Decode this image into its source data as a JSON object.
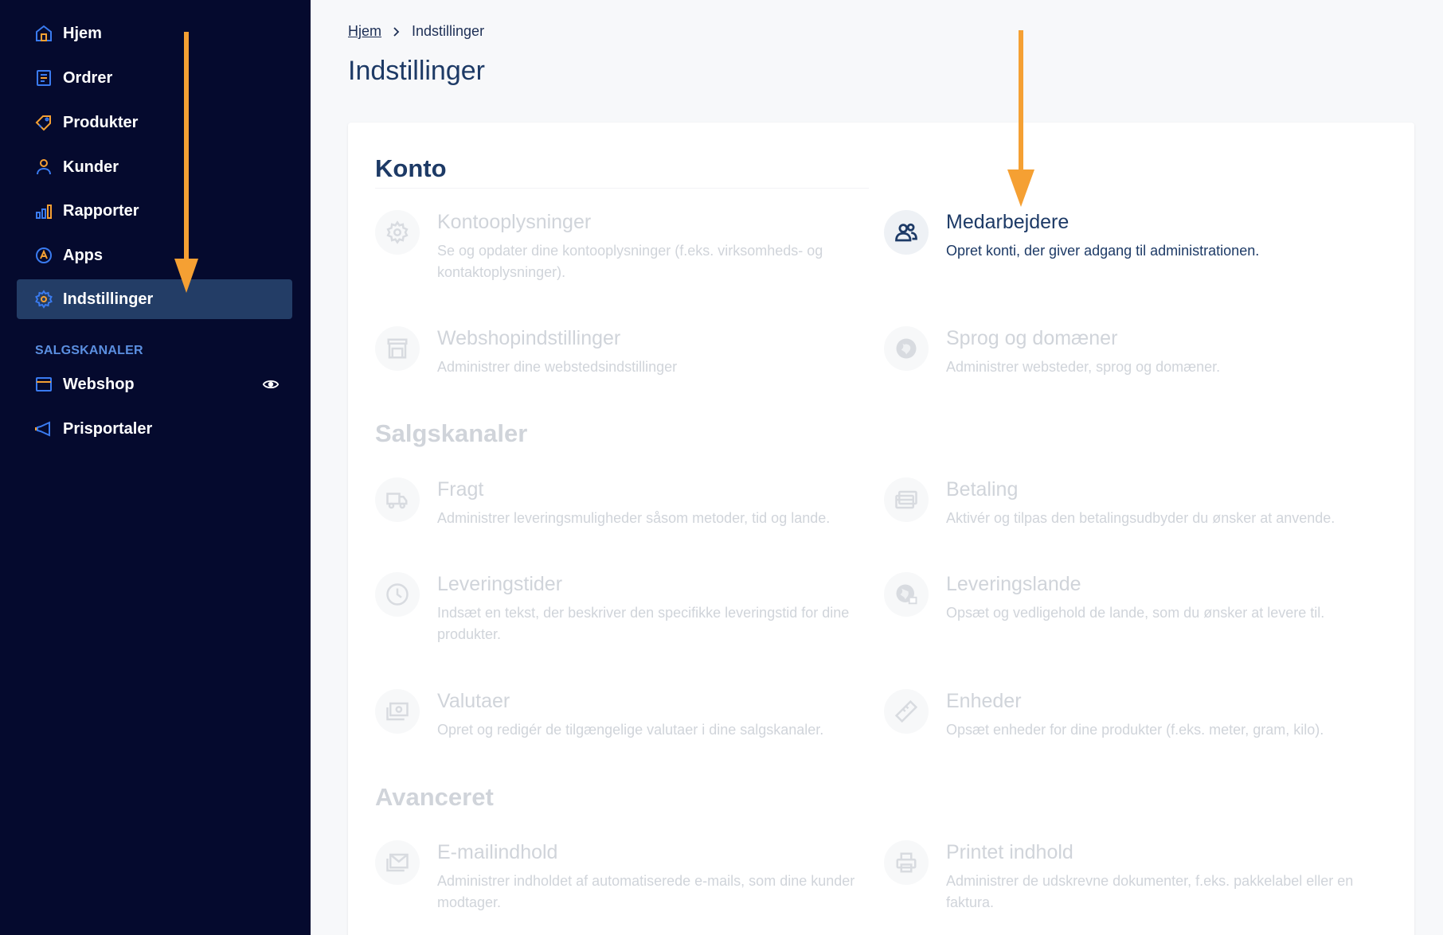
{
  "sidebar": {
    "items": [
      {
        "label": "Hjem",
        "icon": "home-icon"
      },
      {
        "label": "Ordrer",
        "icon": "orders-icon"
      },
      {
        "label": "Produkter",
        "icon": "tag-icon"
      },
      {
        "label": "Kunder",
        "icon": "user-icon"
      },
      {
        "label": "Rapporter",
        "icon": "chart-icon"
      },
      {
        "label": "Apps",
        "icon": "apps-icon"
      },
      {
        "label": "Indstillinger",
        "icon": "gear-icon",
        "active": true
      }
    ],
    "section_label": "SALGSKANALER",
    "channels": [
      {
        "label": "Webshop",
        "icon": "store-icon",
        "badge_icon": "eye-icon"
      },
      {
        "label": "Prisportaler",
        "icon": "megaphone-icon"
      }
    ]
  },
  "breadcrumb": {
    "home": "Hjem",
    "current": "Indstillinger"
  },
  "page_title": "Indstillinger",
  "sections": {
    "konto": {
      "title": "Konto",
      "items": [
        {
          "title": "Kontooplysninger",
          "desc": "Se og opdater dine kontooplysninger (f.eks. virksomheds- og kontaktoplysninger).",
          "icon": "gear-icon"
        },
        {
          "title": "Medarbejdere",
          "desc": "Opret konti, der giver adgang til administrationen.",
          "icon": "users-icon",
          "highlighted": true
        },
        {
          "title": "Webshopindstillinger",
          "desc": "Administrer dine webstedsindstillinger",
          "icon": "store-icon"
        },
        {
          "title": "Sprog og domæner",
          "desc": "Administrer websteder, sprog og domæner.",
          "icon": "globe-icon"
        }
      ]
    },
    "salgskanaler": {
      "title": "Salgskanaler",
      "items": [
        {
          "title": "Fragt",
          "desc": "Administrer leveringsmuligheder såsom metoder, tid og lande.",
          "icon": "truck-icon"
        },
        {
          "title": "Betaling",
          "desc": "Aktivér og tilpas den betalingsudbyder du ønsker at anvende.",
          "icon": "credit-card-icon"
        },
        {
          "title": "Leveringstider",
          "desc": "Indsæt en tekst, der beskriver den specifikke leveringstid for dine produkter.",
          "icon": "clock-icon"
        },
        {
          "title": "Leveringslande",
          "desc": "Opsæt og vedligehold de lande, som du ønsker at levere til.",
          "icon": "globe-delivery-icon"
        },
        {
          "title": "Valutaer",
          "desc": "Opret og redigér de tilgængelige valutaer i dine salgskanaler.",
          "icon": "money-icon"
        },
        {
          "title": "Enheder",
          "desc": "Opsæt enheder for dine produkter (f.eks. meter, gram, kilo).",
          "icon": "ruler-icon"
        }
      ]
    },
    "avanceret": {
      "title": "Avanceret",
      "items": [
        {
          "title": "E-mailindhold",
          "desc": "Administrer indholdet af automatiserede e-mails, som dine kunder modtager.",
          "icon": "mail-icon"
        },
        {
          "title": "Printet indhold",
          "desc": "Administrer de udskrevne dokumenter, f.eks. pakkelabel eller en faktura.",
          "icon": "printer-icon"
        }
      ]
    }
  },
  "colors": {
    "sidebar_bg": "#050a2e",
    "sidebar_active": "#233d66",
    "accent_blue": "#3a7bf0",
    "accent_orange": "#f5a033",
    "text_primary": "#1d3a66",
    "text_muted": "#d0d4da"
  }
}
